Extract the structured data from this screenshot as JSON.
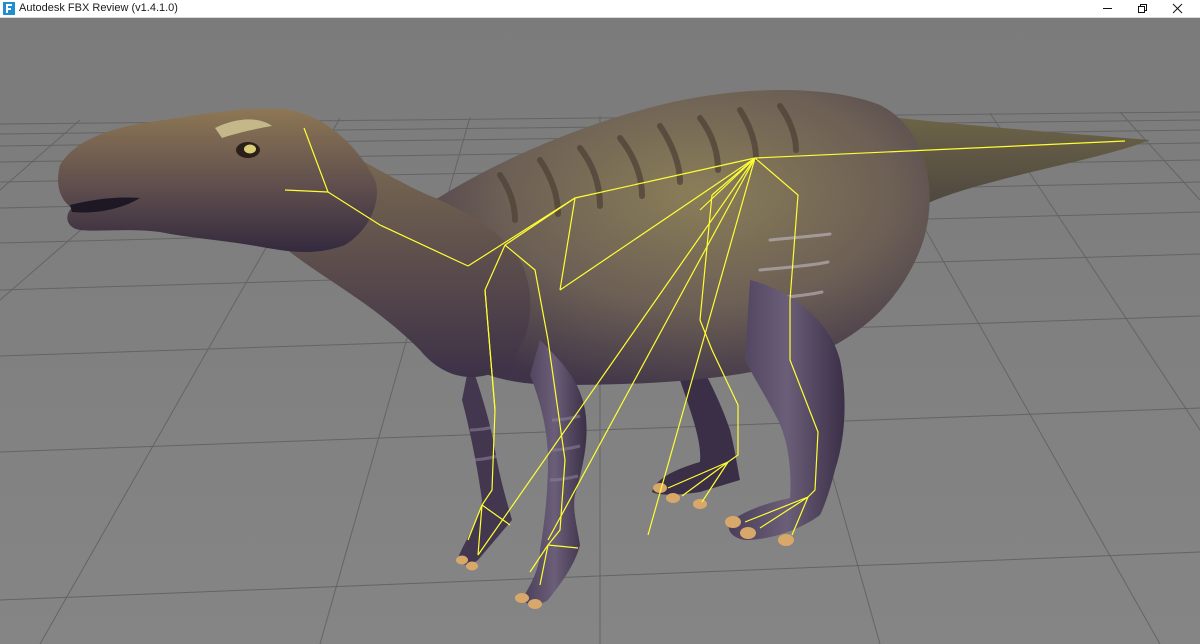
{
  "window": {
    "title": "Autodesk FBX Review (v1.4.1.0)",
    "icon": "fbx-review-app-icon",
    "controls": {
      "minimize": "minimize-icon",
      "maximize": "restore-icon",
      "close": "close-icon"
    }
  },
  "viewport": {
    "background_color": "#7e7e7e",
    "grid_color": "#5f5f5f",
    "skeleton_color": "#ffff33",
    "model": "dinosaur-model",
    "skeleton_visible": true,
    "grid_visible": true
  }
}
